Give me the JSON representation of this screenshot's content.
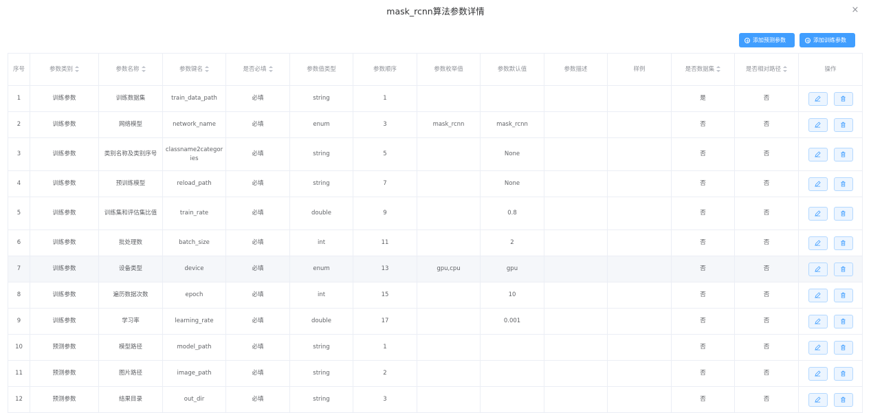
{
  "dialog": {
    "title": "mask_rcnn算法参数详情",
    "close_icon": "×"
  },
  "toolbar": {
    "add_predict_label": "添加预测参数",
    "add_train_label": "添加训练参数"
  },
  "table": {
    "headers": [
      "序号",
      "参数类别",
      "参数名称",
      "参数键名",
      "是否必填",
      "参数值类型",
      "参数顺序",
      "参数枚举值",
      "参数默认值",
      "参数描述",
      "样例",
      "是否数据集",
      "是否相对路径",
      "操作"
    ],
    "sortable": [
      false,
      true,
      true,
      true,
      true,
      false,
      false,
      false,
      false,
      false,
      false,
      true,
      true,
      false
    ],
    "rows": [
      [
        "1",
        "训练参数",
        "训练数据集",
        "train_data_path",
        "必填",
        "string",
        "1",
        "",
        "",
        "",
        "",
        "是",
        "否"
      ],
      [
        "2",
        "训练参数",
        "网络模型",
        "network_name",
        "必填",
        "enum",
        "3",
        "mask_rcnn",
        "mask_rcnn",
        "",
        "",
        "否",
        "否"
      ],
      [
        "3",
        "训练参数",
        "类别名称及类别序号",
        "classname2categories",
        "必填",
        "string",
        "5",
        "",
        "None",
        "",
        "",
        "否",
        "否"
      ],
      [
        "4",
        "训练参数",
        "预训练模型",
        "reload_path",
        "必填",
        "string",
        "7",
        "",
        "None",
        "",
        "",
        "否",
        "否"
      ],
      [
        "5",
        "训练参数",
        "训练集和评估集比值",
        "train_rate",
        "必填",
        "double",
        "9",
        "",
        "0.8",
        "",
        "",
        "否",
        "否"
      ],
      [
        "6",
        "训练参数",
        "批处理数",
        "batch_size",
        "必填",
        "int",
        "11",
        "",
        "2",
        "",
        "",
        "否",
        "否"
      ],
      [
        "7",
        "训练参数",
        "设备类型",
        "device",
        "必填",
        "enum",
        "13",
        "gpu,cpu",
        "gpu",
        "",
        "",
        "否",
        "否"
      ],
      [
        "8",
        "训练参数",
        "遍历数据次数",
        "epoch",
        "必填",
        "int",
        "15",
        "",
        "10",
        "",
        "",
        "否",
        "否"
      ],
      [
        "9",
        "训练参数",
        "学习率",
        "learning_rate",
        "必填",
        "double",
        "17",
        "",
        "0.001",
        "",
        "",
        "否",
        "否"
      ],
      [
        "10",
        "预测参数",
        "模型路径",
        "model_path",
        "必填",
        "string",
        "1",
        "",
        "",
        "",
        "",
        "否",
        "否"
      ],
      [
        "11",
        "预测参数",
        "图片路径",
        "image_path",
        "必填",
        "string",
        "2",
        "",
        "",
        "",
        "",
        "否",
        "否"
      ],
      [
        "12",
        "预测参数",
        "结果目录",
        "out_dir",
        "必填",
        "string",
        "3",
        "",
        "",
        "",
        "",
        "否",
        "否"
      ]
    ],
    "tall_rows": [
      2,
      4
    ],
    "hover_row": 6
  },
  "icons": {
    "edit": "edit-icon",
    "delete": "delete-icon"
  },
  "colors": {
    "primary": "#409eff",
    "border": "#ebeef5",
    "hover_bg": "#f5f7fa"
  }
}
